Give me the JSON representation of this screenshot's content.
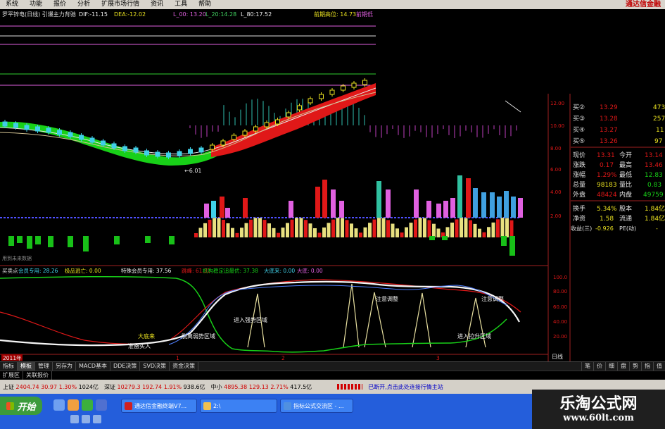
{
  "menu": {
    "items": [
      "系统",
      "功能",
      "报价",
      "分析",
      "扩展市场行情",
      "资讯",
      "工具",
      "帮助"
    ],
    "brand": "通达信金融"
  },
  "chart_header": {
    "title": "罗平锌电(日线) 引爆主力背驰",
    "dif": "DIF:-11.15",
    "dea": "DEA:-12.02",
    "l00": "L_00: 13.20",
    "l20": "L_20:14.28",
    "l80": "L_80:17.52",
    "high_label": "前期高位: 14.73",
    "high2_label": "前期低"
  },
  "indicator_header": {
    "name": "买卖点",
    "member": "会员专用: 28.26",
    "escape": "极品逃亡: 0.00",
    "special": "特殊会员专用: 37.56",
    "jump": "跳峰: 61.31",
    "inst": "机构稳定追最优: 37.38",
    "bottom": "大底来: 0.00",
    "low": "大底: 0.00"
  },
  "mid_label": "用到未来数据",
  "price_low_label": "←6.01",
  "annotations": {
    "strong_zone": "进入强势区域",
    "adjust1": "注意调整",
    "adjust2": "注意调整",
    "weak_zone": "脱离弱势区域",
    "rise_zone": "进入拉升区域",
    "big_bottom": "大底来",
    "bottom_buy": "准备买入"
  },
  "axis_price": [
    "12.00",
    "10.00",
    "8.00",
    "6.00",
    "4.00",
    "2.00"
  ],
  "axis_ind": [
    "100.0",
    "80.00",
    "60.00",
    "40.00",
    "20.00"
  ],
  "time_axis": {
    "year": "2011年",
    "marks": [
      "1",
      "2",
      "3"
    ],
    "period": "日线"
  },
  "quote_panel": {
    "asks": [
      {
        "label": "买②",
        "price": "13.29",
        "vol": "473"
      },
      {
        "label": "买③",
        "price": "13.28",
        "vol": "257"
      },
      {
        "label": "买④",
        "price": "13.27",
        "vol": "11"
      },
      {
        "label": "买⑤",
        "price": "13.26",
        "vol": "97"
      }
    ],
    "rows": [
      {
        "l1": "现价",
        "v1": "13.31",
        "l2": "今开",
        "v2": "13.14"
      },
      {
        "l1": "涨跌",
        "v1": "0.17",
        "l2": "最高",
        "v2": "13.46"
      },
      {
        "l1": "涨幅",
        "v1": "1.29%",
        "l2": "最低",
        "v2": "12.83"
      },
      {
        "l1": "总量",
        "v1": "98183",
        "l2": "量比",
        "v2": "0.83"
      },
      {
        "l1": "外盘",
        "v1": "48424",
        "l2": "内盘",
        "v2": "49759"
      },
      {
        "l1": "换手",
        "v1": "5.34%",
        "l2": "股本",
        "v2": "1.84亿"
      },
      {
        "l1": "净资",
        "v1": "1.58",
        "l2": "流通",
        "v2": "1.84亿"
      },
      {
        "l1": "收益(三)",
        "v1": "-0.926",
        "l2": "PE(动)",
        "v2": "-"
      }
    ]
  },
  "bottom_tabs": [
    "指标",
    "模板",
    "管理",
    "另存为",
    "MACD基本",
    "DDE决策",
    "SVD决策",
    "资金决策"
  ],
  "right_tabs": [
    "笔",
    "价",
    "细",
    "盘",
    "势",
    "指",
    "值"
  ],
  "tabs2": [
    "扩展区",
    "关联报价"
  ],
  "status_bar": {
    "sh_label": "上证",
    "sh_val": "2404.74",
    "sh_chg": "30.97",
    "sh_pct": "1.30%",
    "sh_amt": "1024亿",
    "sz_label": "深证",
    "sz_val": "10279.3",
    "sz_chg": "192.74",
    "sz_pct": "1.91%",
    "sz_amt": "938.6亿",
    "mid_label": "中小",
    "mid_val": "4895.38",
    "mid_chg": "129.13",
    "mid_pct": "2.71%",
    "mid_amt": "417.5亿",
    "msg": "已断开,点击此处连接行情主站"
  },
  "taskbar": {
    "start": "开始",
    "btn1": "通达信金融终端V7...",
    "btn2": "2:\\",
    "btn3": "指标公式交流区 - ..."
  },
  "watermark": {
    "title": "乐淘公式网",
    "url": "www.60lt.com"
  },
  "colors": {
    "red": "#e01818",
    "green": "#18d018",
    "cyan": "#40d0e8",
    "magenta": "#e060e0",
    "yellow": "#e8e020",
    "white": "#f0f0f0"
  }
}
